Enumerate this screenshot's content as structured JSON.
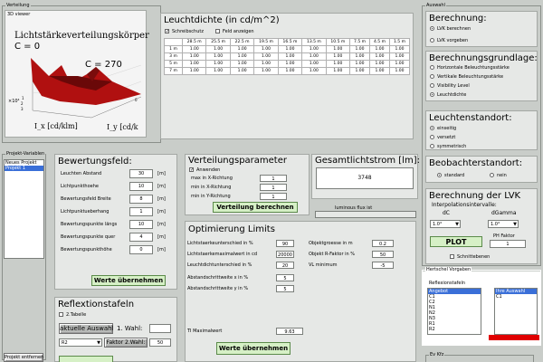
{
  "verteilung": {
    "group": "Verteilung",
    "viewer": "3D viewer",
    "plot_title": "Lichtstärkeverteilungskörper",
    "c0": "C = 0",
    "c270": "C = 270",
    "exp": "×10⁴",
    "xlabel": "I_x [cd/klm]",
    "ylabel": "I_y [cd/k"
  },
  "leuchtdichte": {
    "title": "Leuchtdichte (in cd/m^2)",
    "chk_schreib": "Schreibschutz",
    "chk_feld": "Feld anzeigen",
    "cols": [
      "28.5 m",
      "25.5 m",
      "22.5 m",
      "19.5 m",
      "16.5 m",
      "13.5 m",
      "10.5 m",
      "7.5 m",
      "4.5 m",
      "1.5 m"
    ],
    "rows": [
      {
        "label": "1 m",
        "vals": [
          "1.00",
          "1.00",
          "1.00",
          "1.00",
          "1.00",
          "1.00",
          "1.00",
          "1.00",
          "1.00",
          "1.00"
        ]
      },
      {
        "label": "3 m",
        "vals": [
          "1.00",
          "1.00",
          "1.00",
          "1.00",
          "1.00",
          "1.00",
          "1.00",
          "1.00",
          "1.00",
          "1.00"
        ]
      },
      {
        "label": "5 m",
        "vals": [
          "1.00",
          "1.00",
          "1.00",
          "1.00",
          "1.00",
          "1.00",
          "1.00",
          "1.00",
          "1.00",
          "1.00"
        ]
      },
      {
        "label": "7 m",
        "vals": [
          "1.00",
          "1.00",
          "1.00",
          "1.00",
          "1.00",
          "1.00",
          "1.00",
          "1.00",
          "1.00",
          "1.00"
        ]
      }
    ]
  },
  "auswahl": {
    "group": "Auswahl",
    "berechnung": {
      "title": "Berechnung:",
      "opt1": "LVK berechnen",
      "opt2": "LVK vorgeben"
    },
    "grundlage": {
      "title": "Berechnungsgrundlage:",
      "opts": [
        "Horizontale Beleuchtungsstärke",
        "Vertikale Beleuchtungsstärke",
        "Visibility Level",
        "Leuchtdichte"
      ]
    },
    "standort": {
      "title": "Leuchtenstandort:",
      "opts": [
        "einseitig",
        "versetzt",
        "symmetrisch"
      ]
    },
    "beob": {
      "title": "Beobachterstandort:",
      "opt1": "standard",
      "opt2": "nein"
    },
    "lvk": {
      "title": "Berechnung der LVK",
      "sub": "Interpolationsintervalle:",
      "dc": "dC",
      "dgamma": "dGamma",
      "dc_val": "1.0°",
      "dgamma_val": "1.0°",
      "plot": "PLOT",
      "ph_label": "PH Faktor",
      "ph_val": "1",
      "schnitt": "Schnittebenen"
    }
  },
  "projekt": {
    "group": "Projekt-Variablen",
    "items": [
      "Neues Projekt",
      "Projekt 1"
    ],
    "remove": "Projekt entfernen"
  },
  "bewertung": {
    "title": "Bewertungsfeld:",
    "rows": [
      {
        "label": "Leuchten Abstand",
        "val": "30",
        "unit": "[m]"
      },
      {
        "label": "Lichtpunkthoehe",
        "val": "10",
        "unit": "[m]"
      },
      {
        "label": "Bewertungsfeld Breite",
        "val": "8",
        "unit": "[m]"
      },
      {
        "label": "Lichtpunktueberhang",
        "val": "1",
        "unit": "[m]"
      },
      {
        "label": "Bewertungspunkte längs",
        "val": "10",
        "unit": "[m]"
      },
      {
        "label": "Bewertungspunkte quer",
        "val": "4",
        "unit": "[m]"
      },
      {
        "label": "Bewertungspunkthöhe",
        "val": "0",
        "unit": "[m]"
      }
    ],
    "btn": "Werte übernehmen"
  },
  "verteilungsparam": {
    "title": "Verteilungsparameter",
    "anwenden": "Anwenden",
    "rows": [
      {
        "label": "max in X-Richtung",
        "val": "1"
      },
      {
        "label": "min in X-Richtung",
        "val": "1"
      },
      {
        "label": "min in Y-Richtung",
        "val": "1"
      }
    ],
    "btn": "Verteilung berechnen"
  },
  "gesamt": {
    "title": "Gesamtlichtstrom [lm]:",
    "val": "3748",
    "sub": "luminous flux ist"
  },
  "optimierung": {
    "title": "Optimierung Limits",
    "left": [
      {
        "label": "Lichtstaerkeunterschied in %",
        "val": "90"
      },
      {
        "label": "Lichtstaerkemaximalwert in cd",
        "val": "20000"
      },
      {
        "label": "Leuchtdichtunterschied in %",
        "val": "20"
      },
      {
        "label": "Abstandschrittweite x in %",
        "val": "5"
      },
      {
        "label": "Abstandschrittweite y in %",
        "val": "5"
      }
    ],
    "right": [
      {
        "label": "Objektgroesse in m",
        "val": "0.2"
      },
      {
        "label": "Objekt R-Faktor in %",
        "val": "50"
      },
      {
        "label": "VL minimum",
        "val": "-5"
      }
    ],
    "ti_label": "TI Maximalwert",
    "ti_val": "9.63",
    "btn": "Werte übernehmen"
  },
  "reflexion": {
    "title": "Reflextionstafeln",
    "chk": "2.Tabelle",
    "auswahl": "aktuelle Auswahl",
    "wahl1": "1. Wahl:",
    "r_val": "R2",
    "faktor": "Faktor 2.Wahl:",
    "faktor_val": "50"
  },
  "hertschel": {
    "group": "Hertschel Vorgaben",
    "sub": "Reflexionstafeln",
    "left": [
      "Angebot",
      "C1",
      "C2",
      "N1",
      "N2",
      "N3",
      "R1",
      "R2"
    ],
    "right_header": "Ihre Auswahl",
    "right": [
      "C1"
    ],
    "ev": "Ev Kfz"
  },
  "colors": {
    "accent": "#3a6fd8",
    "plot_red": "#b01010",
    "green_btn": "#d6f0c6"
  }
}
